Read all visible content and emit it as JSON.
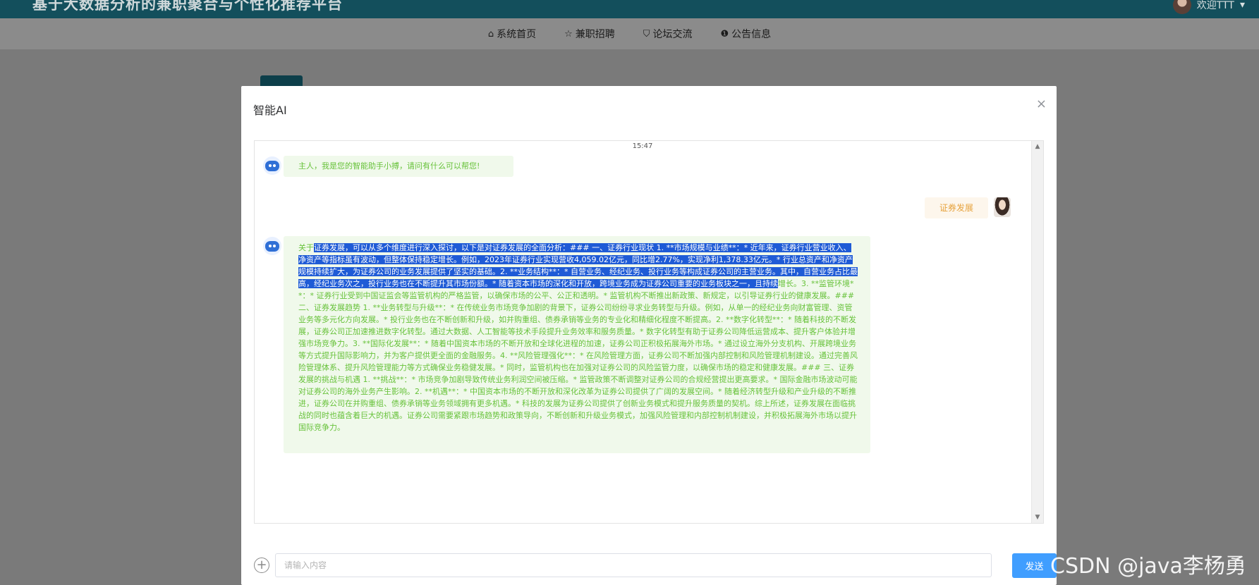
{
  "site": {
    "title": "基于大数据分析的兼职聚合与个性化推荐平台",
    "user_label": "欢迎TTT"
  },
  "nav": {
    "items": [
      {
        "label": "系统首页",
        "icon": "home-icon",
        "glyph": "⌂"
      },
      {
        "label": "兼职招聘",
        "icon": "star-icon",
        "glyph": "☆"
      },
      {
        "label": "论坛交流",
        "icon": "bag-icon",
        "glyph": "⛉"
      },
      {
        "label": "公告信息",
        "icon": "info-icon",
        "glyph": "❶"
      }
    ]
  },
  "modal": {
    "title": "智能AI",
    "close_glyph": "×"
  },
  "chat": {
    "timestamp": "15:47",
    "greeting": "主人，我是您的智能助手小搏，请问有什么可以帮您!",
    "user_message": "证券发展",
    "answer_prefix": "关于",
    "answer_highlight": "证券发展，可以从多个维度进行深入探讨，以下是对证券发展的全面分析：### 一、证券行业现状 1. **市场规模与业绩**：* 近年来，证券行业营业收入、净资产等指标虽有波动，但整体保持稳定增长。例如，2023年证券行业实现营收4,059.02亿元，同比增2.77%，实现净利1,378.33亿元。* 行业总资产和净资产规模持续扩大，为证券公司的业务发展提供了坚实的基础。2. **业务结构**：* 自营业务、经纪业务、投行业务等构成证券公司的主营业务。其中，自营业务占比最高，经纪业务次之，投行业务也在不断提升其市场份额。* 随着资本市场的深化和开放，跨境业务成为证券公司重要的业务板块之一，且持续",
    "answer_rest": "增长。3. **监管环境**：* 证券行业受到中国证监会等监管机构的严格监管，以确保市场的公平、公正和透明。* 监管机构不断推出新政策、新规定，以引导证券行业的健康发展。### 二、证券发展趋势 1. **业务转型与升级**：* 在传统业务市场竞争加剧的背景下，证券公司纷纷寻求业务转型与升级。例如，从单一的经纪业务向财富管理、资管业务等多元化方向发展。* 投行业务也在不断创新和升级，如并购重组、债券承销等业务的专业化和精细化程度不断提高。2. **数字化转型**：* 随着科技的不断发展，证券公司正加速推进数字化转型。通过大数据、人工智能等技术手段提升业务效率和服务质量。* 数字化转型有助于证券公司降低运营成本、提升客户体验并增强市场竞争力。3. **国际化发展**：* 随着中国资本市场的不断开放和全球化进程的加速，证券公司正积极拓展海外市场。* 通过设立海外分支机构、开展跨境业务等方式提升国际影响力，并为客户提供更全面的金融服务。4. **风险管理强化**：* 在风险管理方面，证券公司不断加强内部控制和风险管理机制建设。通过完善风险管理体系、提升风险管理能力等方式确保业务稳健发展。* 同时，监管机构也在加强对证券公司的风险监管力度，以确保市场的稳定和健康发展。### 三、证券发展的挑战与机遇 1. **挑战**：* 市场竞争加剧导致传统业务利润空间被压缩。* 监管政策不断调整对证券公司的合规经营提出更高要求。* 国际金融市场波动可能对证券公司的海外业务产生影响。2. **机遇**：* 中国资本市场的不断开放和深化改革为证券公司提供了广阔的发展空间。* 随着经济转型升级和产业升级的不断推进，证券公司在并购重组、债券承销等业务领域拥有更多机遇。* 科技的发展为证券公司提供了创新业务模式和提升服务质量的契机。综上所述，证券发展在面临挑战的同时也蕴含着巨大的机遇。证券公司需要紧跟市场趋势和政策导向，不断创新和升级业务模式，加强风险管理和内部控制机制建设，并积极拓展海外市场以提升国际竞争力。"
  },
  "composer": {
    "placeholder": "请输入内容",
    "plus_glyph": "+",
    "send_label": "发送"
  },
  "watermark": "CSDN @java李杨勇",
  "colors": {
    "topbar": "#134f5c",
    "accent": "#409eff",
    "bot_bubble_bg": "#f0f9eb",
    "bot_text": "#67c23a",
    "user_bubble_bg": "#fdf6ec",
    "user_text": "#e6a23c",
    "selection": "#1f5bd6"
  }
}
